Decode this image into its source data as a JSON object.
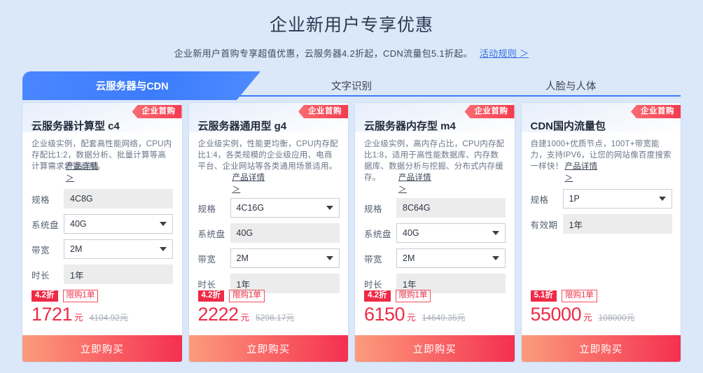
{
  "header": {
    "title": "企业新用户专享优惠",
    "subtitle": "企业新用户首购专享超值优惠，云服务器4.2折起，CDN流量包5.1折起。",
    "rule_link": "活动规则 ＞"
  },
  "tabs": [
    {
      "label": "云服务器与CDN",
      "active": true
    },
    {
      "label": "文字识别",
      "active": false
    },
    {
      "label": "人脸与人体",
      "active": false
    }
  ],
  "colors": {
    "page_bg": "#dbe8fa",
    "tab_active": "#3c7cfb",
    "price_red": "#ee2a45",
    "badge_red": "#f43b4f",
    "buy_gradient_start": "#fb9c7c",
    "buy_gradient_end": "#f43050"
  },
  "detail_link": {
    "label": "产品详情",
    "chevron": "＞"
  },
  "buy_label": "立即购买",
  "cards": [
    {
      "badge": "企业首购",
      "title": "云服务器计算型 c4",
      "desc": "企业级实例，配套高性能网络，CPU内存配比1:2，数据分析、批量计算等高计算需求场景适用。",
      "fields": [
        {
          "label": "规格",
          "value": "4C8G",
          "type": "readonly"
        },
        {
          "label": "系统盘",
          "value": "40G",
          "type": "select"
        },
        {
          "label": "带宽",
          "value": "2M",
          "type": "select"
        },
        {
          "label": "时长",
          "value": "1年",
          "type": "readonly"
        }
      ],
      "discount": "4.2折",
      "limit": "限购1单",
      "price": "1721",
      "unit": "元",
      "original_price": "4104.92元"
    },
    {
      "badge": "企业首购",
      "title": "云服务器通用型 g4",
      "desc": "企业级实例，性能更均衡，CPU内存配比1:4，各类规模的企业级应用、电商平台、企业网站等各类通用场景适用。",
      "fields": [
        {
          "label": "规格",
          "value": "4C16G",
          "type": "select"
        },
        {
          "label": "系统盘",
          "value": "40G",
          "type": "readonly"
        },
        {
          "label": "带宽",
          "value": "2M",
          "type": "select"
        },
        {
          "label": "时长",
          "value": "1年",
          "type": "readonly"
        }
      ],
      "discount": "4.2折",
      "limit": "限购1单",
      "price": "2222",
      "unit": "元",
      "original_price": "5298.17元"
    },
    {
      "badge": "企业首购",
      "title": "云服务器内存型 m4",
      "desc": "企业级实例，高内存占比，CPU内存配比1:8，适用于高性能数据库、内存数据库、数据分析与挖掘、分布式内存缓存。",
      "fields": [
        {
          "label": "规格",
          "value": "8C64G",
          "type": "readonly"
        },
        {
          "label": "系统盘",
          "value": "40G",
          "type": "select"
        },
        {
          "label": "带宽",
          "value": "2M",
          "type": "select"
        },
        {
          "label": "时长",
          "value": "1年",
          "type": "readonly"
        }
      ],
      "discount": "4.2折",
      "limit": "限购1单",
      "price": "6150",
      "unit": "元",
      "original_price": "14649.35元"
    },
    {
      "badge": "企业首购",
      "title": "CDN国内流量包",
      "desc": "自建1000+优质节点，100T+带宽能力，支持IPV6，让您的网站像百度搜索一样快！",
      "fields": [
        {
          "label": "规格",
          "value": "1P",
          "type": "select"
        },
        {
          "label": "有效期",
          "value": "1年",
          "type": "readonly"
        }
      ],
      "discount": "5.1折",
      "limit": "限购1单",
      "price": "55000",
      "unit": "元",
      "original_price": "108000元"
    }
  ]
}
